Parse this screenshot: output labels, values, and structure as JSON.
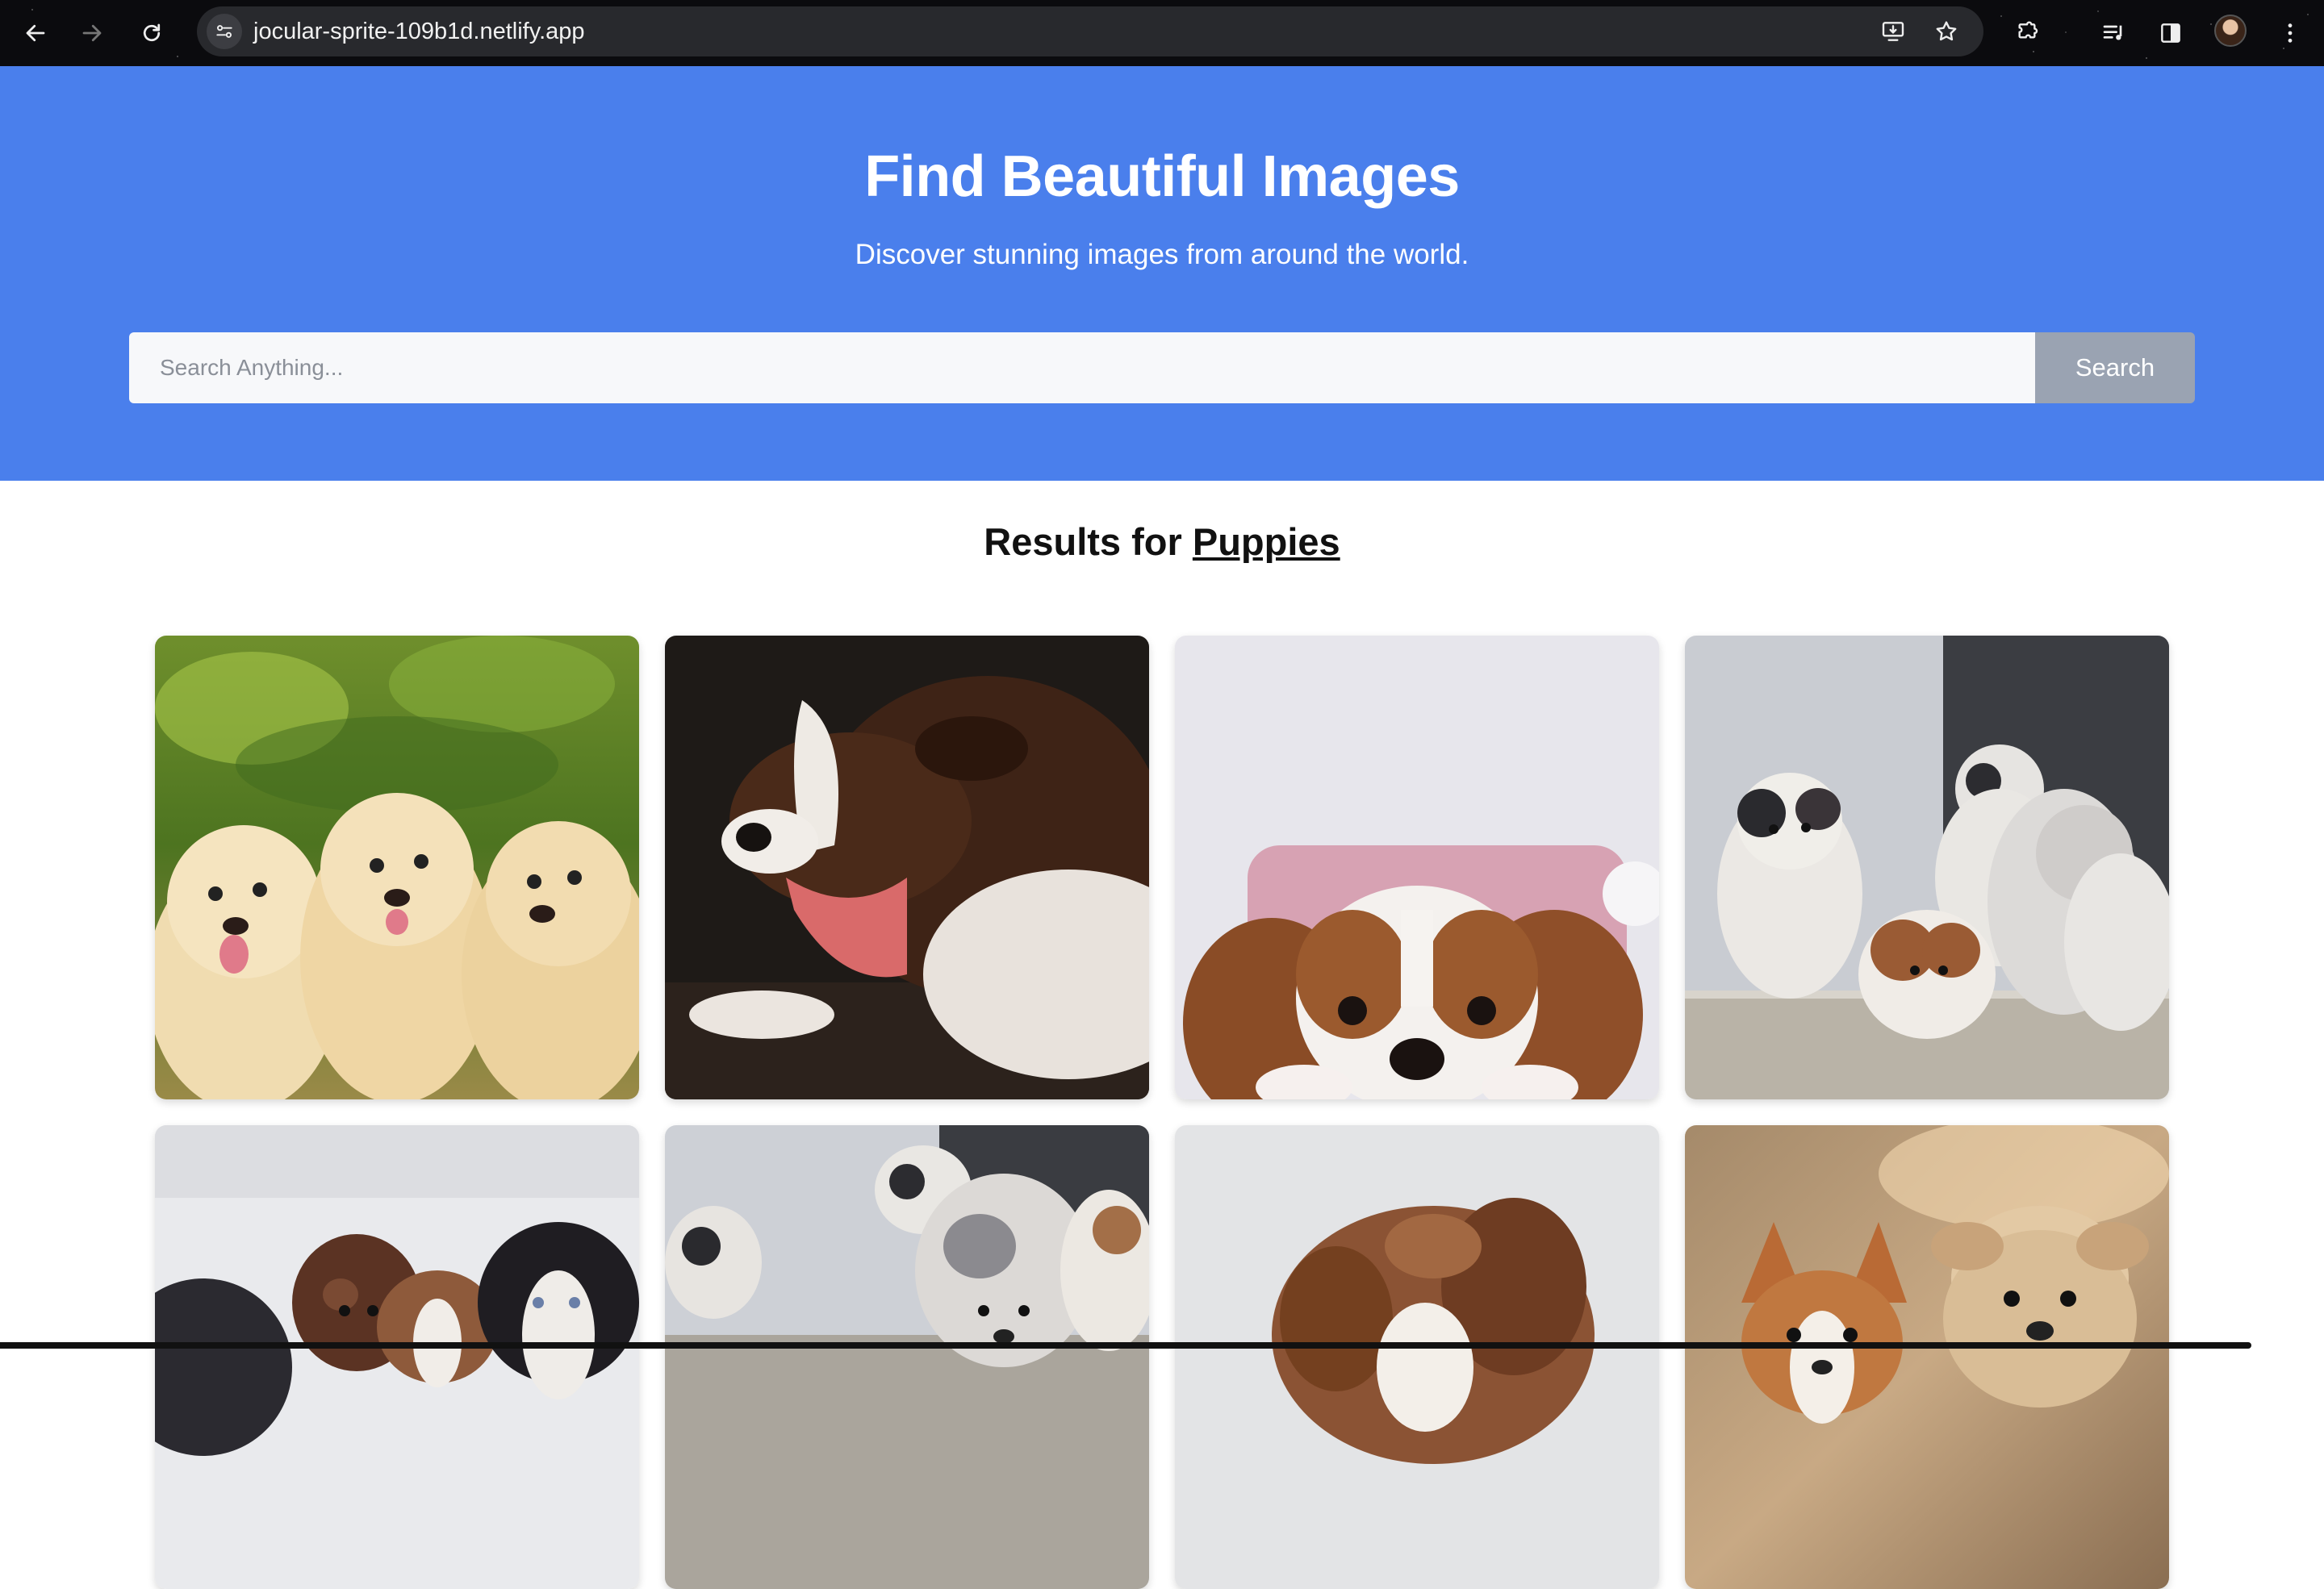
{
  "browser": {
    "url": "jocular-sprite-109b1d.netlify.app",
    "icons": [
      "back-arrow-icon",
      "forward-arrow-icon",
      "reload-icon",
      "site-settings-icon",
      "install-app-icon",
      "bookmark-star-icon",
      "extensions-icon",
      "media-controls-icon",
      "side-panel-icon",
      "profile-avatar",
      "more-menu-icon"
    ]
  },
  "hero": {
    "title": "Find Beautiful Images",
    "subtitle": "Discover stunning images from around the world.",
    "background": "#4a7fec"
  },
  "search": {
    "placeholder": "Search Anything...",
    "value": "",
    "button_label": "Search"
  },
  "results": {
    "prefix": "Results for",
    "query": "Puppies",
    "images": [
      "three golden retriever puppies",
      "yawning brown and white puppy",
      "cavalier puppy on pink pillow",
      "australian shepherd puppies on step",
      "puppies lying together",
      "australian shepherd puppies",
      "brown puppy",
      "corgi and yorkie"
    ]
  }
}
